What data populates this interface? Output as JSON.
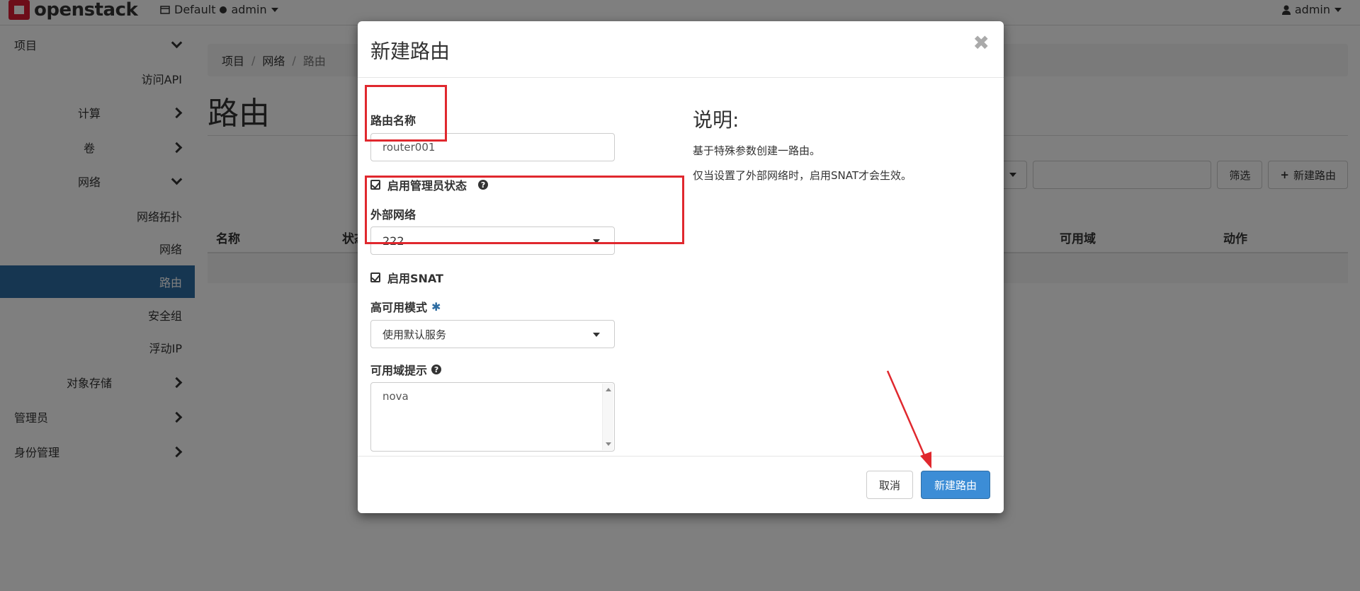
{
  "navbar": {
    "logo_text": "openstack",
    "domain": "Default",
    "project": "admin",
    "user": "admin"
  },
  "sidebar": {
    "items": [
      {
        "label": "项目",
        "chevron": "down"
      },
      {
        "label": "访问API",
        "chevron": ""
      },
      {
        "label": "计算",
        "chevron": "right"
      },
      {
        "label": "卷",
        "chevron": "right"
      },
      {
        "label": "网络",
        "chevron": "down"
      },
      {
        "label": "网络拓扑",
        "chevron": ""
      },
      {
        "label": "网络",
        "chevron": ""
      },
      {
        "label": "路由",
        "chevron": "",
        "active": true
      },
      {
        "label": "安全组",
        "chevron": ""
      },
      {
        "label": "浮动IP",
        "chevron": ""
      },
      {
        "label": "对象存储",
        "chevron": "right"
      },
      {
        "label": "管理员",
        "chevron": "right"
      },
      {
        "label": "身份管理",
        "chevron": "right"
      }
    ]
  },
  "breadcrumb": [
    "项目",
    "网络",
    "路由"
  ],
  "page": {
    "title": "路由",
    "filter_label": "筛选",
    "create_label": "新建路由",
    "columns": [
      "名称",
      "状态",
      "可用域",
      "动作"
    ]
  },
  "modal": {
    "title": "新建路由",
    "close_symbol": "✖",
    "router_name_label": "路由名称",
    "router_name_value": "router001",
    "admin_state_label": "启用管理员状态",
    "external_network_label": "外部网络",
    "external_network_value": "222",
    "enable_snat_label": "启用SNAT",
    "ha_mode_label": "高可用模式",
    "ha_mode_value": "使用默认服务",
    "az_hint_label": "可用域提示",
    "az_hint_value": "nova",
    "desc_title": "说明:",
    "desc_line1": "基于特殊参数创建一路由。",
    "desc_line2": "仅当设置了外部网络时，启用SNAT才会生效。",
    "cancel_label": "取消",
    "submit_label": "新建路由"
  },
  "colors": {
    "active_nav": "#2d6ca2",
    "primary_button": "#3c8dd6",
    "annotation_red": "#e0282e"
  }
}
